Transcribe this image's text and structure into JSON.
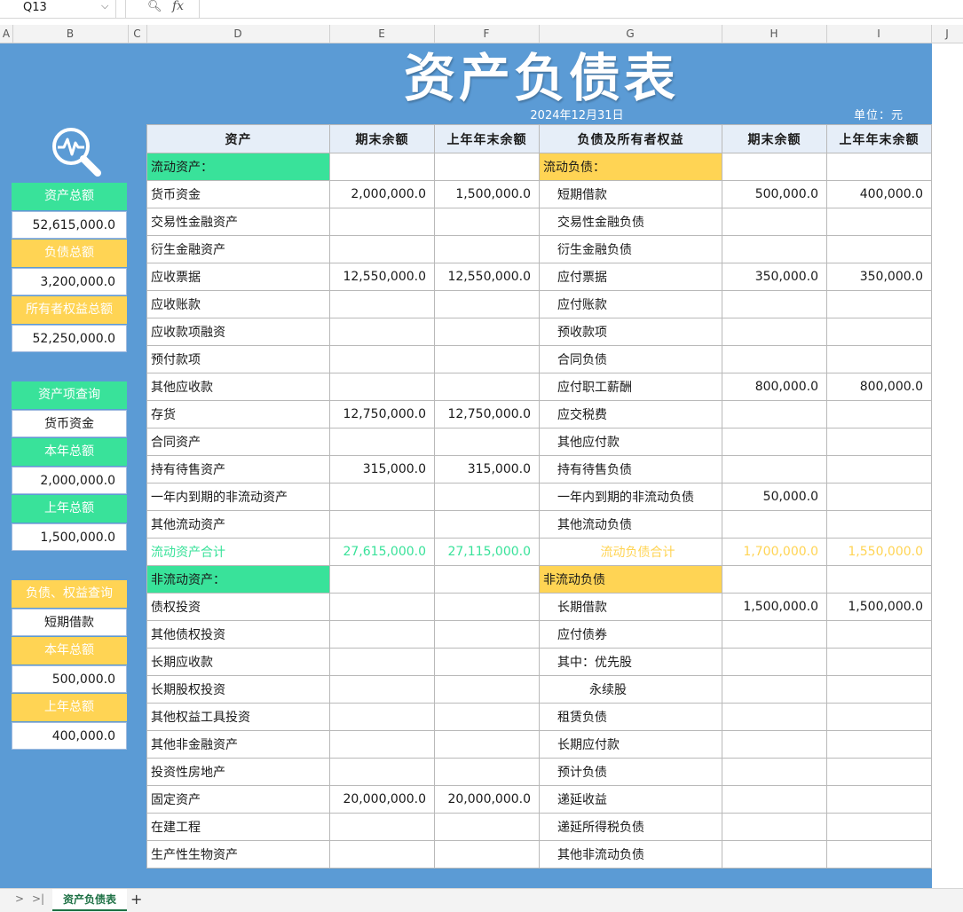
{
  "formula_bar": {
    "cell_ref": "Q13",
    "zoom_icon": "zoom-icon",
    "fx_label": "fx"
  },
  "columns": [
    "A",
    "B",
    "C",
    "D",
    "E",
    "F",
    "G",
    "H",
    "I",
    "J"
  ],
  "sheet": {
    "title": "资产负债表",
    "date": "2024年12月31日",
    "unit": "单位：元",
    "accent_colors": {
      "background": "#5b9bd5",
      "green": "#39e29a",
      "yellow": "#ffd454"
    }
  },
  "side_panel": {
    "total_assets_label": "资产总额",
    "total_assets_value": "52,615,000.0",
    "total_liabilities_label": "负债总额",
    "total_liabilities_value": "3,200,000.0",
    "total_equity_label": "所有者权益总额",
    "total_equity_value": "52,250,000.0",
    "asset_query_label": "资产项查询",
    "asset_query_value": "货币资金",
    "asset_current_label": "本年总额",
    "asset_current_value": "2,000,000.0",
    "asset_prior_label": "上年总额",
    "asset_prior_value": "1,500,000.0",
    "liab_query_label": "负债、权益查询",
    "liab_query_value": "短期借款",
    "liab_current_label": "本年总额",
    "liab_current_value": "500,000.0",
    "liab_prior_label": "上年总额",
    "liab_prior_value": "400,000.0"
  },
  "table": {
    "headers": [
      "资产",
      "期末余额",
      "上年年末余额",
      "负债及所有者权益",
      "期末余额",
      "上年年末余额"
    ],
    "rows": [
      [
        "流动资产：",
        "",
        "",
        "流动负债：",
        "",
        ""
      ],
      [
        "货币资金",
        "2,000,000.0",
        "1,500,000.0",
        "短期借款",
        "500,000.0",
        "400,000.0"
      ],
      [
        "交易性金融资产",
        "",
        "",
        "交易性金融负债",
        "",
        ""
      ],
      [
        "衍生金融资产",
        "",
        "",
        "衍生金融负债",
        "",
        ""
      ],
      [
        "应收票据",
        "12,550,000.0",
        "12,550,000.0",
        "应付票据",
        "350,000.0",
        "350,000.0"
      ],
      [
        "应收账款",
        "",
        "",
        "应付账款",
        "",
        ""
      ],
      [
        "应收款项融资",
        "",
        "",
        "预收款项",
        "",
        ""
      ],
      [
        "预付款项",
        "",
        "",
        "合同负债",
        "",
        ""
      ],
      [
        "其他应收款",
        "",
        "",
        "应付职工薪酬",
        "800,000.0",
        "800,000.0"
      ],
      [
        "存货",
        "12,750,000.0",
        "12,750,000.0",
        "应交税费",
        "",
        ""
      ],
      [
        "合同资产",
        "",
        "",
        "其他应付款",
        "",
        ""
      ],
      [
        "持有待售资产",
        "315,000.0",
        "315,000.0",
        "持有待售负债",
        "",
        ""
      ],
      [
        "一年内到期的非流动资产",
        "",
        "",
        "一年内到期的非流动负债",
        "50,000.0",
        ""
      ],
      [
        "其他流动资产",
        "",
        "",
        "其他流动负债",
        "",
        ""
      ],
      [
        "流动资产合计",
        "27,615,000.0",
        "27,115,000.0",
        "流动负债合计",
        "1,700,000.0",
        "1,550,000.0"
      ],
      [
        "非流动资产：",
        "",
        "",
        "非流动负债",
        "",
        ""
      ],
      [
        "债权投资",
        "",
        "",
        "长期借款",
        "1,500,000.0",
        "1,500,000.0"
      ],
      [
        "其他债权投资",
        "",
        "",
        "应付债券",
        "",
        ""
      ],
      [
        "长期应收款",
        "",
        "",
        "其中：优先股",
        "",
        ""
      ],
      [
        "长期股权投资",
        "",
        "",
        "永续股",
        "",
        ""
      ],
      [
        "其他权益工具投资",
        "",
        "",
        "租赁负债",
        "",
        ""
      ],
      [
        "其他非金融资产",
        "",
        "",
        "长期应付款",
        "",
        ""
      ],
      [
        "投资性房地产",
        "",
        "",
        "预计负债",
        "",
        ""
      ],
      [
        "固定资产",
        "20,000,000.0",
        "20,000,000.0",
        "递延收益",
        "",
        ""
      ],
      [
        "在建工程",
        "",
        "",
        "递延所得税负债",
        "",
        ""
      ],
      [
        "生产性生物资产",
        "",
        "",
        "其他非流动负债",
        "",
        ""
      ]
    ]
  },
  "sheet_tabs": {
    "active": "资产负债表",
    "add": "+"
  }
}
